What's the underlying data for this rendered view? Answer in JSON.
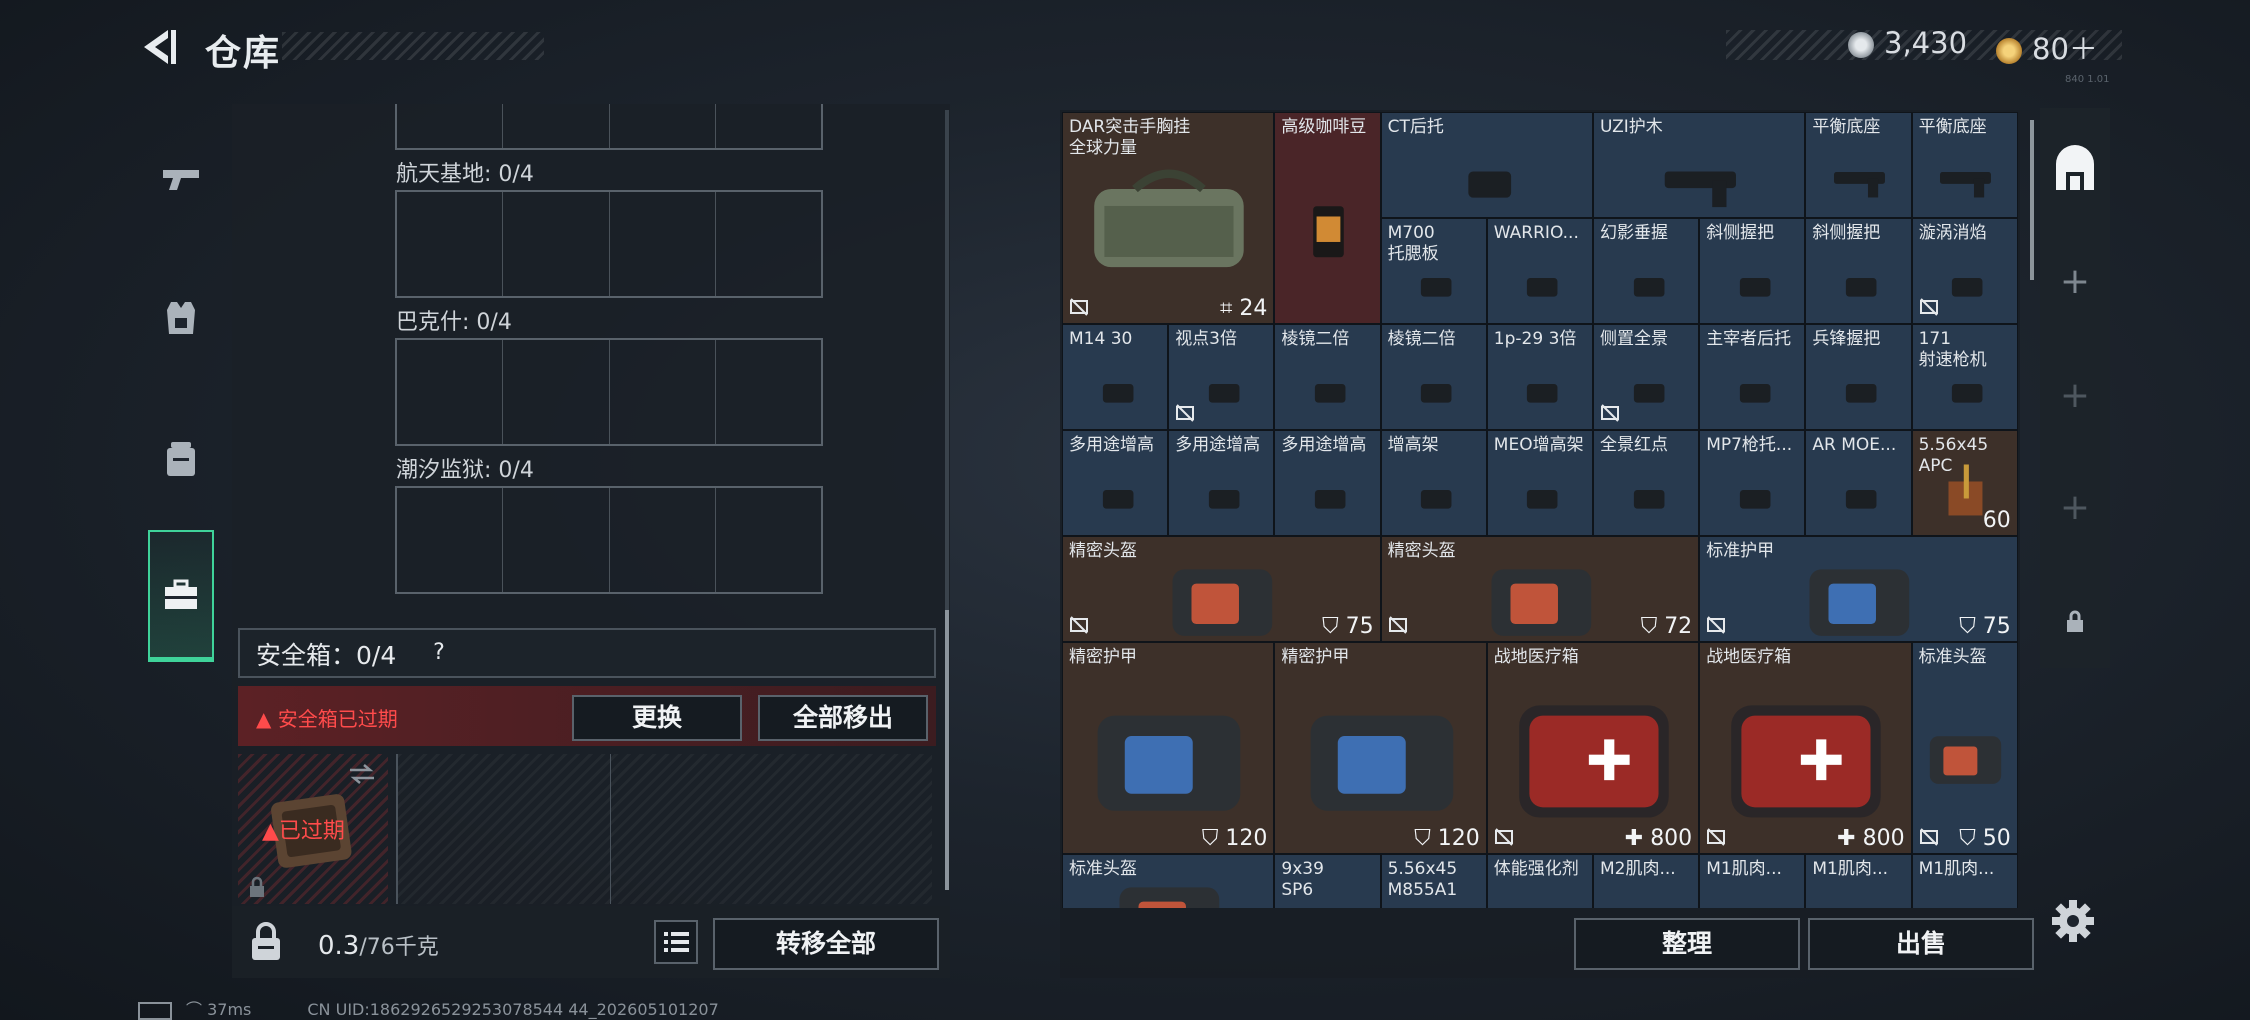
{
  "header": {
    "title": "仓库"
  },
  "currency": [
    {
      "name": "silver-coin",
      "value": "3,430",
      "color": "#c8ced4"
    },
    {
      "name": "gold-coin",
      "value": "80＋",
      "color": "#d9a440"
    }
  ],
  "left_nav": [
    {
      "name": "weapons",
      "icon": "pistol-icon"
    },
    {
      "name": "armor",
      "icon": "vest-icon"
    },
    {
      "name": "backpack",
      "icon": "backpack-icon"
    },
    {
      "name": "case",
      "icon": "toolbox-icon",
      "selected": true
    }
  ],
  "regions": [
    {
      "label": "航天基地: 0/4"
    },
    {
      "label": "巴克什: 0/4"
    },
    {
      "label": "潮汐监狱: 0/4"
    }
  ],
  "safebox": {
    "label": "安全箱：0/4",
    "help": "?",
    "expired_warning": "安全箱已过期",
    "replace": "更换",
    "remove_all": "全部移出",
    "expired_tag": "已过期"
  },
  "left_bottom": {
    "weight_value": "0.3",
    "weight_capacity": "/76千克",
    "transfer_all": "转移全部"
  },
  "items": [
    {
      "name": "DAR突击手胸挂\n全球力量",
      "value": "24",
      "bg": "#3d3029"
    },
    {
      "name": "高级咖啡豆",
      "value": "",
      "bg": "#4a2528"
    },
    {
      "name": "CT后托",
      "value": "",
      "bg": "#283a4f"
    },
    {
      "name": "UZI护木",
      "value": "",
      "bg": "#283a4f"
    },
    {
      "name": "平衡底座",
      "value": "",
      "bg": "#283a4f"
    },
    {
      "name": "平衡底座",
      "value": "",
      "bg": "#283a4f"
    },
    {
      "name": "M700\n托腮板",
      "value": "",
      "bg": "#283a4f"
    },
    {
      "name": "WARRIO...",
      "value": "",
      "bg": "#283a4f"
    },
    {
      "name": "幻影垂握",
      "value": "",
      "bg": "#283a4f"
    },
    {
      "name": "斜侧握把",
      "value": "",
      "bg": "#283a4f"
    },
    {
      "name": "斜侧握把",
      "value": "",
      "bg": "#283a4f"
    },
    {
      "name": "漩涡消焰",
      "value": "",
      "bg": "#283a4f"
    },
    {
      "name": "M14 30",
      "value": "",
      "bg": "#283a4f"
    },
    {
      "name": "视点3倍",
      "value": "",
      "bg": "#283a4f"
    },
    {
      "name": "棱镜二倍",
      "value": "",
      "bg": "#283a4f"
    },
    {
      "name": "棱镜二倍",
      "value": "",
      "bg": "#283a4f"
    },
    {
      "name": "1p-29 3倍",
      "value": "",
      "bg": "#283a4f"
    },
    {
      "name": "侧置全景",
      "value": "",
      "bg": "#283a4f"
    },
    {
      "name": "主宰者后托",
      "value": "",
      "bg": "#283a4f"
    },
    {
      "name": "兵锋握把",
      "value": "",
      "bg": "#283a4f"
    },
    {
      "name": "171\n射速枪机",
      "value": "",
      "bg": "#283a4f"
    },
    {
      "name": "多用途增高",
      "value": "",
      "bg": "#283a4f"
    },
    {
      "name": "多用途增高",
      "value": "",
      "bg": "#283a4f"
    },
    {
      "name": "多用途增高",
      "value": "",
      "bg": "#283a4f"
    },
    {
      "name": "增高架",
      "value": "",
      "bg": "#283a4f"
    },
    {
      "name": "MEO增高架",
      "value": "",
      "bg": "#283a4f"
    },
    {
      "name": "全景红点",
      "value": "",
      "bg": "#283a4f"
    },
    {
      "name": "MP7枪托...",
      "value": "",
      "bg": "#283a4f"
    },
    {
      "name": "AR MOE...",
      "value": "",
      "bg": "#283a4f"
    },
    {
      "name": "5.56x45\nAPC",
      "value": "60",
      "bg": "#3d3029"
    },
    {
      "name": "精密头盔",
      "value": "75",
      "bg": "#3d3029"
    },
    {
      "name": "精密头盔",
      "value": "72",
      "bg": "#3d3029"
    },
    {
      "name": "标准护甲",
      "value": "75",
      "bg": "#283a4f"
    },
    {
      "name": "精密护甲",
      "value": "120",
      "bg": "#3d3029"
    },
    {
      "name": "精密护甲",
      "value": "120",
      "bg": "#3d3029"
    },
    {
      "name": "战地医疗箱",
      "value": "800",
      "bg": "#3d3029"
    },
    {
      "name": "战地医疗箱",
      "value": "800",
      "bg": "#3d3029"
    },
    {
      "name": "标准头盔",
      "value": "50",
      "bg": "#283a4f"
    },
    {
      "name": "标准头盔",
      "value": "",
      "bg": "#283a4f"
    },
    {
      "name": "9x39\nSP6",
      "value": "",
      "bg": "#283a4f"
    },
    {
      "name": "5.56x45\nM855A1",
      "value": "",
      "bg": "#283a4f"
    },
    {
      "name": "体能强化剂",
      "value": "",
      "bg": "#283a4f"
    },
    {
      "name": "M2肌肉...",
      "value": "",
      "bg": "#283a4f"
    },
    {
      "name": "M1肌肉...",
      "value": "",
      "bg": "#283a4f"
    },
    {
      "name": "M1肌肉...",
      "value": "",
      "bg": "#283a4f"
    },
    {
      "name": "M1肌肉...",
      "value": "",
      "bg": "#283a4f"
    }
  ],
  "right_bottom": {
    "sort": "整理",
    "sell": "出售"
  },
  "side_tabs": [
    {
      "icon": "storage-icon",
      "label": ""
    },
    {
      "icon": "plus-icon",
      "label": "+"
    },
    {
      "icon": "plus-icon",
      "label": "+"
    },
    {
      "icon": "plus-icon",
      "label": "+"
    },
    {
      "icon": "lock-icon",
      "label": ""
    }
  ],
  "status": {
    "ping": "37ms",
    "uid": "CN UID:1862926529253078544 44_202605101207"
  },
  "version": "840 1.01"
}
